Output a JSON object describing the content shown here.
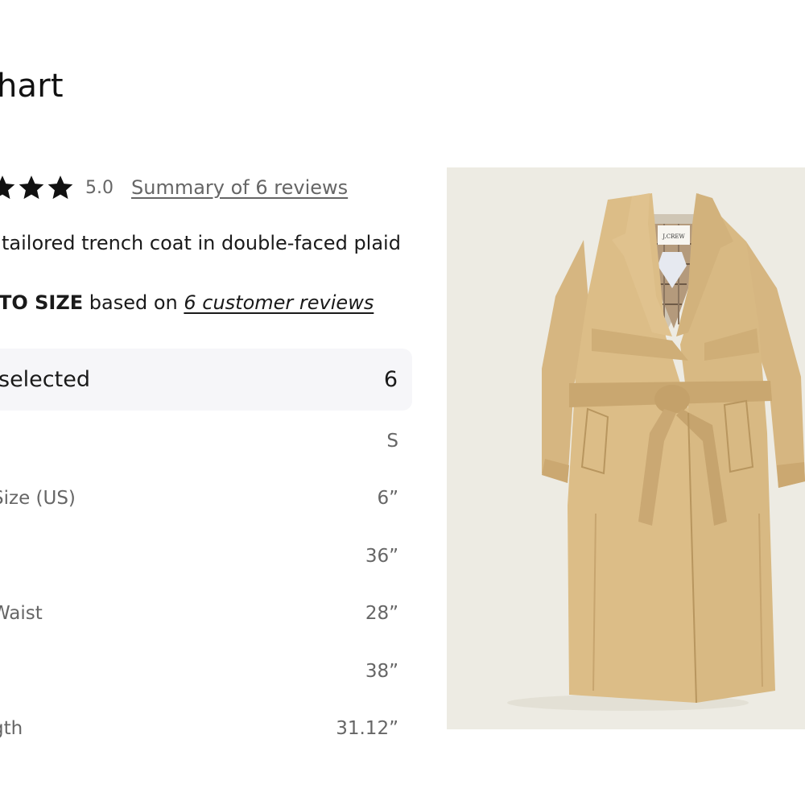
{
  "page": {
    "title": "hart"
  },
  "rating": {
    "stars": 3,
    "value": "5.0",
    "reviews_link": "Summary of 6 reviews"
  },
  "product": {
    "description": "tailored trench coat in double-faced plaid",
    "image_alt": "trench-coat-image",
    "brand_label": "J.CREW"
  },
  "fit": {
    "bold": "TO SIZE",
    "middle": " based on ",
    "link": "6 customer reviews"
  },
  "size_selector": {
    "label": "selected",
    "count": "6"
  },
  "measurements": [
    {
      "label": ")",
      "value": "S"
    },
    {
      "label": "Size (US)",
      "value": "6”"
    },
    {
      "label": "",
      "value": "36”"
    },
    {
      "label": "Waist",
      "value": "28”"
    },
    {
      "label": "",
      "value": "38”"
    },
    {
      "label": "gth",
      "value": "31.12”"
    }
  ],
  "colors": {
    "coat": "#d8b983",
    "image_bg": "#edebe3",
    "text_muted": "#666666",
    "header_bg": "#f6f6f9"
  }
}
